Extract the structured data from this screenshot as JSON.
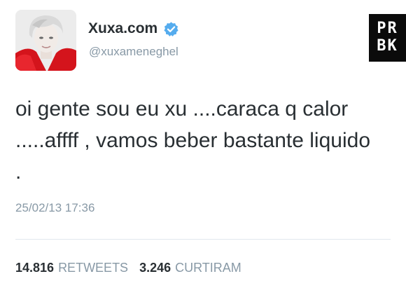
{
  "user": {
    "display_name": "Xuxa.com",
    "handle": "@xuxameneghel",
    "verified": true,
    "avatar_icon": "profile-photo"
  },
  "tweet": {
    "text": "oi gente sou eu xu ....caraca q calor .....affff , vamos beber bastante liquido .",
    "timestamp": "25/02/13 17:36"
  },
  "stats": {
    "retweets_count": "14.816",
    "retweets_label": "RETWEETS",
    "likes_count": "3.246",
    "likes_label": "CURTIRAM"
  },
  "watermark": {
    "line1": "PR",
    "line2": "BK"
  },
  "colors": {
    "text": "#292f33",
    "muted": "#8899a6",
    "verified": "#55acee",
    "divider": "#e1e8ed"
  }
}
